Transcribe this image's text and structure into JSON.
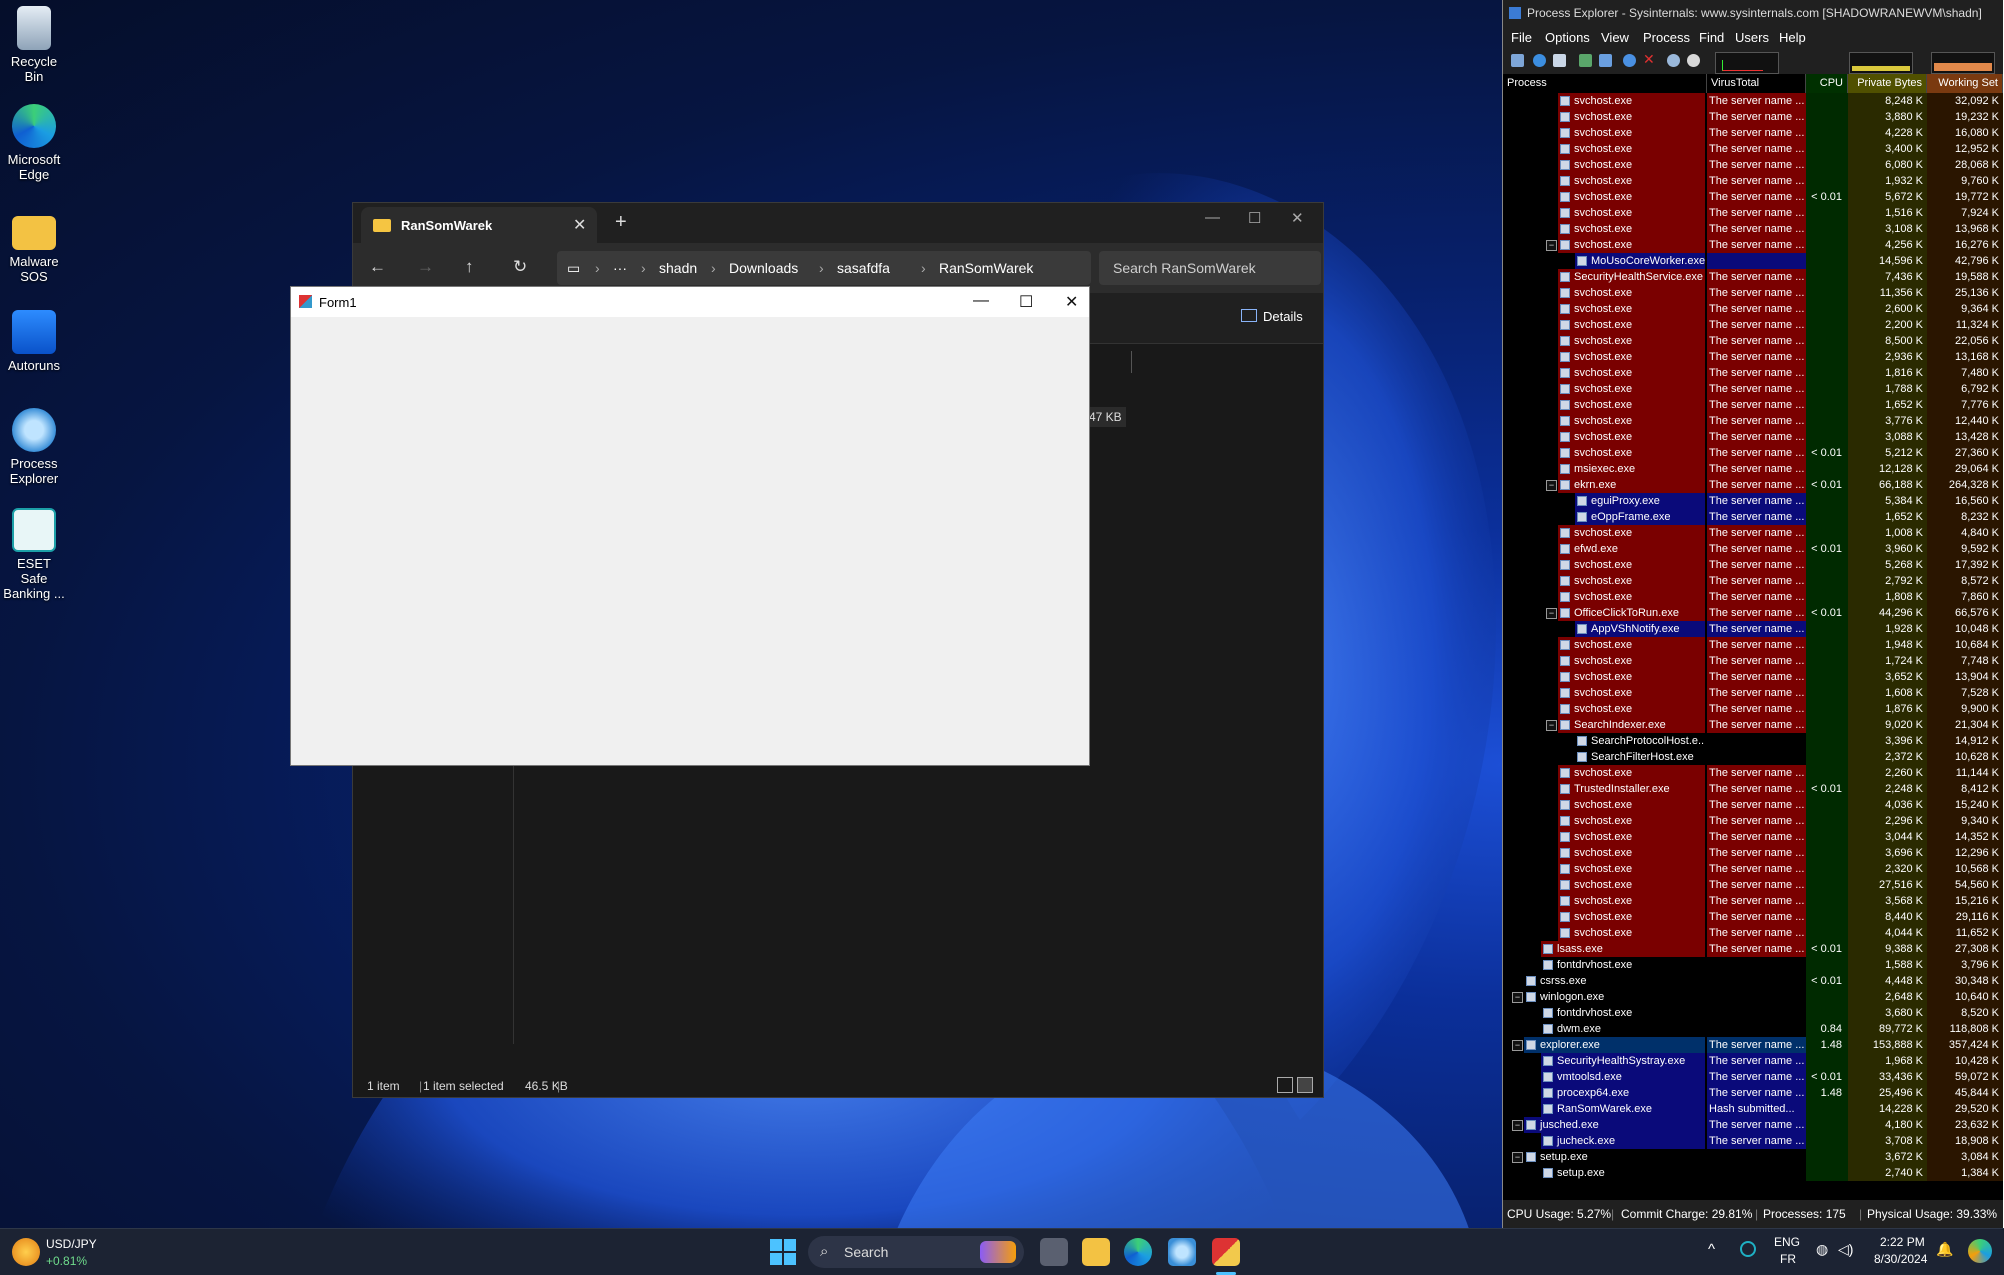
{
  "desktop": {
    "icons": [
      {
        "label": "Recycle Bin"
      },
      {
        "label": "Microsoft Edge"
      },
      {
        "label": "Malware SOS"
      },
      {
        "label": "Autoruns"
      },
      {
        "label": "Process Explorer"
      },
      {
        "label": "ESET Safe Banking ..."
      }
    ]
  },
  "explorer": {
    "tab_title": "RanSomWarek",
    "breadcrumbs": [
      "shadn",
      "Downloads",
      "sasafdfa",
      "RanSomWarek"
    ],
    "search_placeholder": "Search RanSomWarek",
    "details_label": "Details",
    "file_size": "47 KB",
    "status": {
      "items": "1 item",
      "selected": "1 item selected",
      "size": "46.5 KB"
    }
  },
  "form1": {
    "title": "Form1"
  },
  "procexp": {
    "title": "Process Explorer - Sysinternals: www.sysinternals.com [SHADOWRANEWVM\\shadn]",
    "menu": [
      "File",
      "Options",
      "View",
      "Process",
      "Find",
      "Users",
      "Help"
    ],
    "columns": [
      "Process",
      "VirusTotal",
      "CPU",
      "Private Bytes",
      "Working Set"
    ],
    "rows": [
      {
        "name": "svchost.exe",
        "vt": "The server name ...",
        "cpu": "",
        "pb": "8,248 K",
        "ws": "32,092 K",
        "color": "#7a0000",
        "indent": 3,
        "tog": ""
      },
      {
        "name": "svchost.exe",
        "vt": "The server name ...",
        "cpu": "",
        "pb": "3,880 K",
        "ws": "19,232 K",
        "color": "#7a0000",
        "indent": 3,
        "tog": ""
      },
      {
        "name": "svchost.exe",
        "vt": "The server name ...",
        "cpu": "",
        "pb": "4,228 K",
        "ws": "16,080 K",
        "color": "#7a0000",
        "indent": 3,
        "tog": ""
      },
      {
        "name": "svchost.exe",
        "vt": "The server name ...",
        "cpu": "",
        "pb": "3,400 K",
        "ws": "12,952 K",
        "color": "#7a0000",
        "indent": 3,
        "tog": ""
      },
      {
        "name": "svchost.exe",
        "vt": "The server name ...",
        "cpu": "",
        "pb": "6,080 K",
        "ws": "28,068 K",
        "color": "#7a0000",
        "indent": 3,
        "tog": ""
      },
      {
        "name": "svchost.exe",
        "vt": "The server name ...",
        "cpu": "",
        "pb": "1,932 K",
        "ws": "9,760 K",
        "color": "#7a0000",
        "indent": 3,
        "tog": ""
      },
      {
        "name": "svchost.exe",
        "vt": "The server name ...",
        "cpu": "< 0.01",
        "pb": "5,672 K",
        "ws": "19,772 K",
        "color": "#7a0000",
        "indent": 3,
        "tog": ""
      },
      {
        "name": "svchost.exe",
        "vt": "The server name ...",
        "cpu": "",
        "pb": "1,516 K",
        "ws": "7,924 K",
        "color": "#7a0000",
        "indent": 3,
        "tog": ""
      },
      {
        "name": "svchost.exe",
        "vt": "The server name ...",
        "cpu": "",
        "pb": "3,108 K",
        "ws": "13,968 K",
        "color": "#7a0000",
        "indent": 3,
        "tog": ""
      },
      {
        "name": "svchost.exe",
        "vt": "The server name ...",
        "cpu": "",
        "pb": "4,256 K",
        "ws": "16,276 K",
        "color": "#7a0000",
        "indent": 3,
        "tog": "−"
      },
      {
        "name": "MoUsoCoreWorker.exe",
        "vt": "",
        "cpu": "",
        "pb": "14,596 K",
        "ws": "42,796 K",
        "color": "#0a0a7a",
        "indent": 4,
        "tog": ""
      },
      {
        "name": "SecurityHealthService.exe",
        "vt": "The server name ...",
        "cpu": "",
        "pb": "7,436 K",
        "ws": "19,588 K",
        "color": "#7a0000",
        "indent": 3,
        "tog": ""
      },
      {
        "name": "svchost.exe",
        "vt": "The server name ...",
        "cpu": "",
        "pb": "11,356 K",
        "ws": "25,136 K",
        "color": "#7a0000",
        "indent": 3,
        "tog": ""
      },
      {
        "name": "svchost.exe",
        "vt": "The server name ...",
        "cpu": "",
        "pb": "2,600 K",
        "ws": "9,364 K",
        "color": "#7a0000",
        "indent": 3,
        "tog": ""
      },
      {
        "name": "svchost.exe",
        "vt": "The server name ...",
        "cpu": "",
        "pb": "2,200 K",
        "ws": "11,324 K",
        "color": "#7a0000",
        "indent": 3,
        "tog": ""
      },
      {
        "name": "svchost.exe",
        "vt": "The server name ...",
        "cpu": "",
        "pb": "8,500 K",
        "ws": "22,056 K",
        "color": "#7a0000",
        "indent": 3,
        "tog": ""
      },
      {
        "name": "svchost.exe",
        "vt": "The server name ...",
        "cpu": "",
        "pb": "2,936 K",
        "ws": "13,168 K",
        "color": "#7a0000",
        "indent": 3,
        "tog": ""
      },
      {
        "name": "svchost.exe",
        "vt": "The server name ...",
        "cpu": "",
        "pb": "1,816 K",
        "ws": "7,480 K",
        "color": "#7a0000",
        "indent": 3,
        "tog": ""
      },
      {
        "name": "svchost.exe",
        "vt": "The server name ...",
        "cpu": "",
        "pb": "1,788 K",
        "ws": "6,792 K",
        "color": "#7a0000",
        "indent": 3,
        "tog": ""
      },
      {
        "name": "svchost.exe",
        "vt": "The server name ...",
        "cpu": "",
        "pb": "1,652 K",
        "ws": "7,776 K",
        "color": "#7a0000",
        "indent": 3,
        "tog": ""
      },
      {
        "name": "svchost.exe",
        "vt": "The server name ...",
        "cpu": "",
        "pb": "3,776 K",
        "ws": "12,440 K",
        "color": "#7a0000",
        "indent": 3,
        "tog": ""
      },
      {
        "name": "svchost.exe",
        "vt": "The server name ...",
        "cpu": "",
        "pb": "3,088 K",
        "ws": "13,428 K",
        "color": "#7a0000",
        "indent": 3,
        "tog": ""
      },
      {
        "name": "svchost.exe",
        "vt": "The server name ...",
        "cpu": "< 0.01",
        "pb": "5,212 K",
        "ws": "27,360 K",
        "color": "#7a0000",
        "indent": 3,
        "tog": ""
      },
      {
        "name": "msiexec.exe",
        "vt": "The server name ...",
        "cpu": "",
        "pb": "12,128 K",
        "ws": "29,064 K",
        "color": "#7a0000",
        "indent": 3,
        "tog": ""
      },
      {
        "name": "ekrn.exe",
        "vt": "The server name ...",
        "cpu": "< 0.01",
        "pb": "66,188 K",
        "ws": "264,328 K",
        "color": "#7a0000",
        "indent": 3,
        "tog": "−"
      },
      {
        "name": "eguiProxy.exe",
        "vt": "The server name ...",
        "cpu": "",
        "pb": "5,384 K",
        "ws": "16,560 K",
        "color": "#0a0a7a",
        "indent": 4,
        "tog": ""
      },
      {
        "name": "eOppFrame.exe",
        "vt": "The server name ...",
        "cpu": "",
        "pb": "1,652 K",
        "ws": "8,232 K",
        "color": "#0a0a7a",
        "indent": 4,
        "tog": ""
      },
      {
        "name": "svchost.exe",
        "vt": "The server name ...",
        "cpu": "",
        "pb": "1,008 K",
        "ws": "4,840 K",
        "color": "#7a0000",
        "indent": 3,
        "tog": ""
      },
      {
        "name": "efwd.exe",
        "vt": "The server name ...",
        "cpu": "< 0.01",
        "pb": "3,960 K",
        "ws": "9,592 K",
        "color": "#7a0000",
        "indent": 3,
        "tog": ""
      },
      {
        "name": "svchost.exe",
        "vt": "The server name ...",
        "cpu": "",
        "pb": "5,268 K",
        "ws": "17,392 K",
        "color": "#7a0000",
        "indent": 3,
        "tog": ""
      },
      {
        "name": "svchost.exe",
        "vt": "The server name ...",
        "cpu": "",
        "pb": "2,792 K",
        "ws": "8,572 K",
        "color": "#7a0000",
        "indent": 3,
        "tog": ""
      },
      {
        "name": "svchost.exe",
        "vt": "The server name ...",
        "cpu": "",
        "pb": "1,808 K",
        "ws": "7,860 K",
        "color": "#7a0000",
        "indent": 3,
        "tog": ""
      },
      {
        "name": "OfficeClickToRun.exe",
        "vt": "The server name ...",
        "cpu": "< 0.01",
        "pb": "44,296 K",
        "ws": "66,576 K",
        "color": "#7a0000",
        "indent": 3,
        "tog": "−"
      },
      {
        "name": "AppVShNotify.exe",
        "vt": "The server name ...",
        "cpu": "",
        "pb": "1,928 K",
        "ws": "10,048 K",
        "color": "#0a0a7a",
        "indent": 4,
        "tog": ""
      },
      {
        "name": "svchost.exe",
        "vt": "The server name ...",
        "cpu": "",
        "pb": "1,948 K",
        "ws": "10,684 K",
        "color": "#7a0000",
        "indent": 3,
        "tog": ""
      },
      {
        "name": "svchost.exe",
        "vt": "The server name ...",
        "cpu": "",
        "pb": "1,724 K",
        "ws": "7,748 K",
        "color": "#7a0000",
        "indent": 3,
        "tog": ""
      },
      {
        "name": "svchost.exe",
        "vt": "The server name ...",
        "cpu": "",
        "pb": "3,652 K",
        "ws": "13,904 K",
        "color": "#7a0000",
        "indent": 3,
        "tog": ""
      },
      {
        "name": "svchost.exe",
        "vt": "The server name ...",
        "cpu": "",
        "pb": "1,608 K",
        "ws": "7,528 K",
        "color": "#7a0000",
        "indent": 3,
        "tog": ""
      },
      {
        "name": "svchost.exe",
        "vt": "The server name ...",
        "cpu": "",
        "pb": "1,876 K",
        "ws": "9,900 K",
        "color": "#7a0000",
        "indent": 3,
        "tog": ""
      },
      {
        "name": "SearchIndexer.exe",
        "vt": "The server name ...",
        "cpu": "",
        "pb": "9,020 K",
        "ws": "21,304 K",
        "color": "#7a0000",
        "indent": 3,
        "tog": "−"
      },
      {
        "name": "SearchProtocolHost.e...",
        "vt": "",
        "cpu": "",
        "pb": "3,396 K",
        "ws": "14,912 K",
        "color": "",
        "indent": 4,
        "tog": ""
      },
      {
        "name": "SearchFilterHost.exe",
        "vt": "",
        "cpu": "",
        "pb": "2,372 K",
        "ws": "10,628 K",
        "color": "",
        "indent": 4,
        "tog": ""
      },
      {
        "name": "svchost.exe",
        "vt": "The server name ...",
        "cpu": "",
        "pb": "2,260 K",
        "ws": "11,144 K",
        "color": "#7a0000",
        "indent": 3,
        "tog": ""
      },
      {
        "name": "TrustedInstaller.exe",
        "vt": "The server name ...",
        "cpu": "< 0.01",
        "pb": "2,248 K",
        "ws": "8,412 K",
        "color": "#7a0000",
        "indent": 3,
        "tog": ""
      },
      {
        "name": "svchost.exe",
        "vt": "The server name ...",
        "cpu": "",
        "pb": "4,036 K",
        "ws": "15,240 K",
        "color": "#7a0000",
        "indent": 3,
        "tog": ""
      },
      {
        "name": "svchost.exe",
        "vt": "The server name ...",
        "cpu": "",
        "pb": "2,296 K",
        "ws": "9,340 K",
        "color": "#7a0000",
        "indent": 3,
        "tog": ""
      },
      {
        "name": "svchost.exe",
        "vt": "The server name ...",
        "cpu": "",
        "pb": "3,044 K",
        "ws": "14,352 K",
        "color": "#7a0000",
        "indent": 3,
        "tog": ""
      },
      {
        "name": "svchost.exe",
        "vt": "The server name ...",
        "cpu": "",
        "pb": "3,696 K",
        "ws": "12,296 K",
        "color": "#7a0000",
        "indent": 3,
        "tog": ""
      },
      {
        "name": "svchost.exe",
        "vt": "The server name ...",
        "cpu": "",
        "pb": "2,320 K",
        "ws": "10,568 K",
        "color": "#7a0000",
        "indent": 3,
        "tog": ""
      },
      {
        "name": "svchost.exe",
        "vt": "The server name ...",
        "cpu": "",
        "pb": "27,516 K",
        "ws": "54,560 K",
        "color": "#7a0000",
        "indent": 3,
        "tog": ""
      },
      {
        "name": "svchost.exe",
        "vt": "The server name ...",
        "cpu": "",
        "pb": "3,568 K",
        "ws": "15,216 K",
        "color": "#7a0000",
        "indent": 3,
        "tog": ""
      },
      {
        "name": "svchost.exe",
        "vt": "The server name ...",
        "cpu": "",
        "pb": "8,440 K",
        "ws": "29,116 K",
        "color": "#7a0000",
        "indent": 3,
        "tog": ""
      },
      {
        "name": "svchost.exe",
        "vt": "The server name ...",
        "cpu": "",
        "pb": "4,044 K",
        "ws": "11,652 K",
        "color": "#7a0000",
        "indent": 3,
        "tog": ""
      },
      {
        "name": "lsass.exe",
        "vt": "The server name ...",
        "cpu": "< 0.01",
        "pb": "9,388 K",
        "ws": "27,308 K",
        "color": "#7a0000",
        "indent": 2,
        "tog": ""
      },
      {
        "name": "fontdrvhost.exe",
        "vt": "",
        "cpu": "",
        "pb": "1,588 K",
        "ws": "3,796 K",
        "color": "",
        "indent": 2,
        "tog": ""
      },
      {
        "name": "csrss.exe",
        "vt": "",
        "cpu": "< 0.01",
        "pb": "4,448 K",
        "ws": "30,348 K",
        "color": "",
        "indent": 1,
        "tog": ""
      },
      {
        "name": "winlogon.exe",
        "vt": "",
        "cpu": "",
        "pb": "2,648 K",
        "ws": "10,640 K",
        "color": "",
        "indent": 1,
        "tog": "−"
      },
      {
        "name": "fontdrvhost.exe",
        "vt": "",
        "cpu": "",
        "pb": "3,680 K",
        "ws": "8,520 K",
        "color": "",
        "indent": 2,
        "tog": ""
      },
      {
        "name": "dwm.exe",
        "vt": "",
        "cpu": "0.84",
        "pb": "89,772 K",
        "ws": "118,808 K",
        "color": "",
        "indent": 2,
        "tog": ""
      },
      {
        "name": "explorer.exe",
        "vt": "The server name ...",
        "cpu": "1.48",
        "pb": "153,888 K",
        "ws": "357,424 K",
        "color": "#00306a",
        "indent": 1,
        "tog": "−"
      },
      {
        "name": "SecurityHealthSystray.exe",
        "vt": "The server name ...",
        "cpu": "",
        "pb": "1,968 K",
        "ws": "10,428 K",
        "color": "#0a0a7a",
        "indent": 2,
        "tog": ""
      },
      {
        "name": "vmtoolsd.exe",
        "vt": "The server name ...",
        "cpu": "< 0.01",
        "pb": "33,436 K",
        "ws": "59,072 K",
        "color": "#0a0a7a",
        "indent": 2,
        "tog": ""
      },
      {
        "name": "procexp64.exe",
        "vt": "The server name ...",
        "cpu": "1.48",
        "pb": "25,496 K",
        "ws": "45,844 K",
        "color": "#0a0a7a",
        "indent": 2,
        "tog": ""
      },
      {
        "name": "RanSomWarek.exe",
        "vt": "Hash submitted...",
        "cpu": "",
        "pb": "14,228 K",
        "ws": "29,520 K",
        "color": "#0a0a7a",
        "indent": 2,
        "tog": ""
      },
      {
        "name": "jusched.exe",
        "vt": "The server name ...",
        "cpu": "",
        "pb": "4,180 K",
        "ws": "23,632 K",
        "color": "#0a0a7a",
        "indent": 1,
        "tog": "−"
      },
      {
        "name": "jucheck.exe",
        "vt": "The server name ...",
        "cpu": "",
        "pb": "3,708 K",
        "ws": "18,908 K",
        "color": "#0a0a7a",
        "indent": 2,
        "tog": ""
      },
      {
        "name": "setup.exe",
        "vt": "",
        "cpu": "",
        "pb": "3,672 K",
        "ws": "3,084 K",
        "color": "",
        "indent": 1,
        "tog": "−"
      },
      {
        "name": "setup.exe",
        "vt": "",
        "cpu": "",
        "pb": "2,740 K",
        "ws": "1,384 K",
        "color": "",
        "indent": 2,
        "tog": ""
      }
    ],
    "status": {
      "cpu": "CPU Usage: 5.27%",
      "commit": "Commit Charge: 29.81%",
      "processes": "Processes: 175",
      "physical": "Physical Usage: 39.33%"
    }
  },
  "taskbar": {
    "widget_title": "USD/JPY",
    "widget_value": "+0.81%",
    "search_label": "Search",
    "lang_top": "ENG",
    "lang_bottom": "FR",
    "time": "2:22 PM",
    "date": "8/30/2024"
  },
  "colors": {
    "service_row": "#7a0000",
    "user_row": "#0a0a7a",
    "accent": "#0078d4"
  }
}
